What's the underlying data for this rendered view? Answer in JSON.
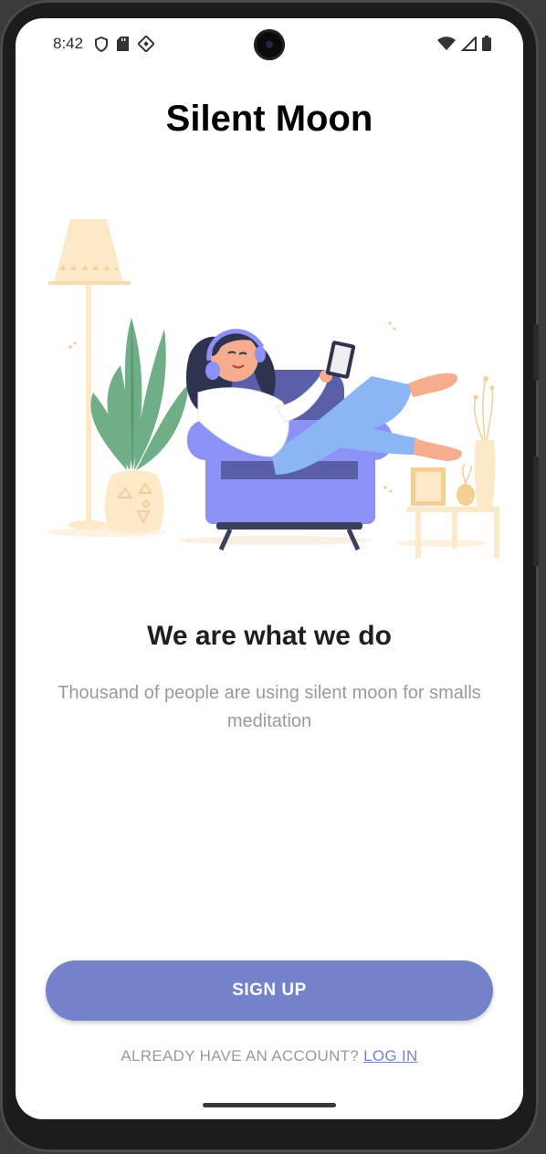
{
  "status_bar": {
    "time": "8:42",
    "left_icons": [
      "shield-icon",
      "sd-card-icon",
      "app-shortcut-icon"
    ],
    "right_icons": [
      "wifi-icon",
      "cellular-signal-icon",
      "battery-icon"
    ]
  },
  "app": {
    "title": "Silent Moon"
  },
  "onboarding": {
    "headline": "We are what we do",
    "subtitle": "Thousand of people are using silent moon for smalls meditation",
    "illustration": "woman-relaxing-on-armchair-illustration"
  },
  "actions": {
    "signup_label": "SIGN UP",
    "login_prompt": "ALREADY HAVE AN ACCOUNT?",
    "login_link": "LOG IN"
  },
  "colors": {
    "accent": "#7483c9",
    "title": "#000000",
    "subtitle": "#9a9a9a",
    "armchair": "#8c91f5",
    "lamp": "#fde8c8",
    "plant": "#6fae86"
  }
}
